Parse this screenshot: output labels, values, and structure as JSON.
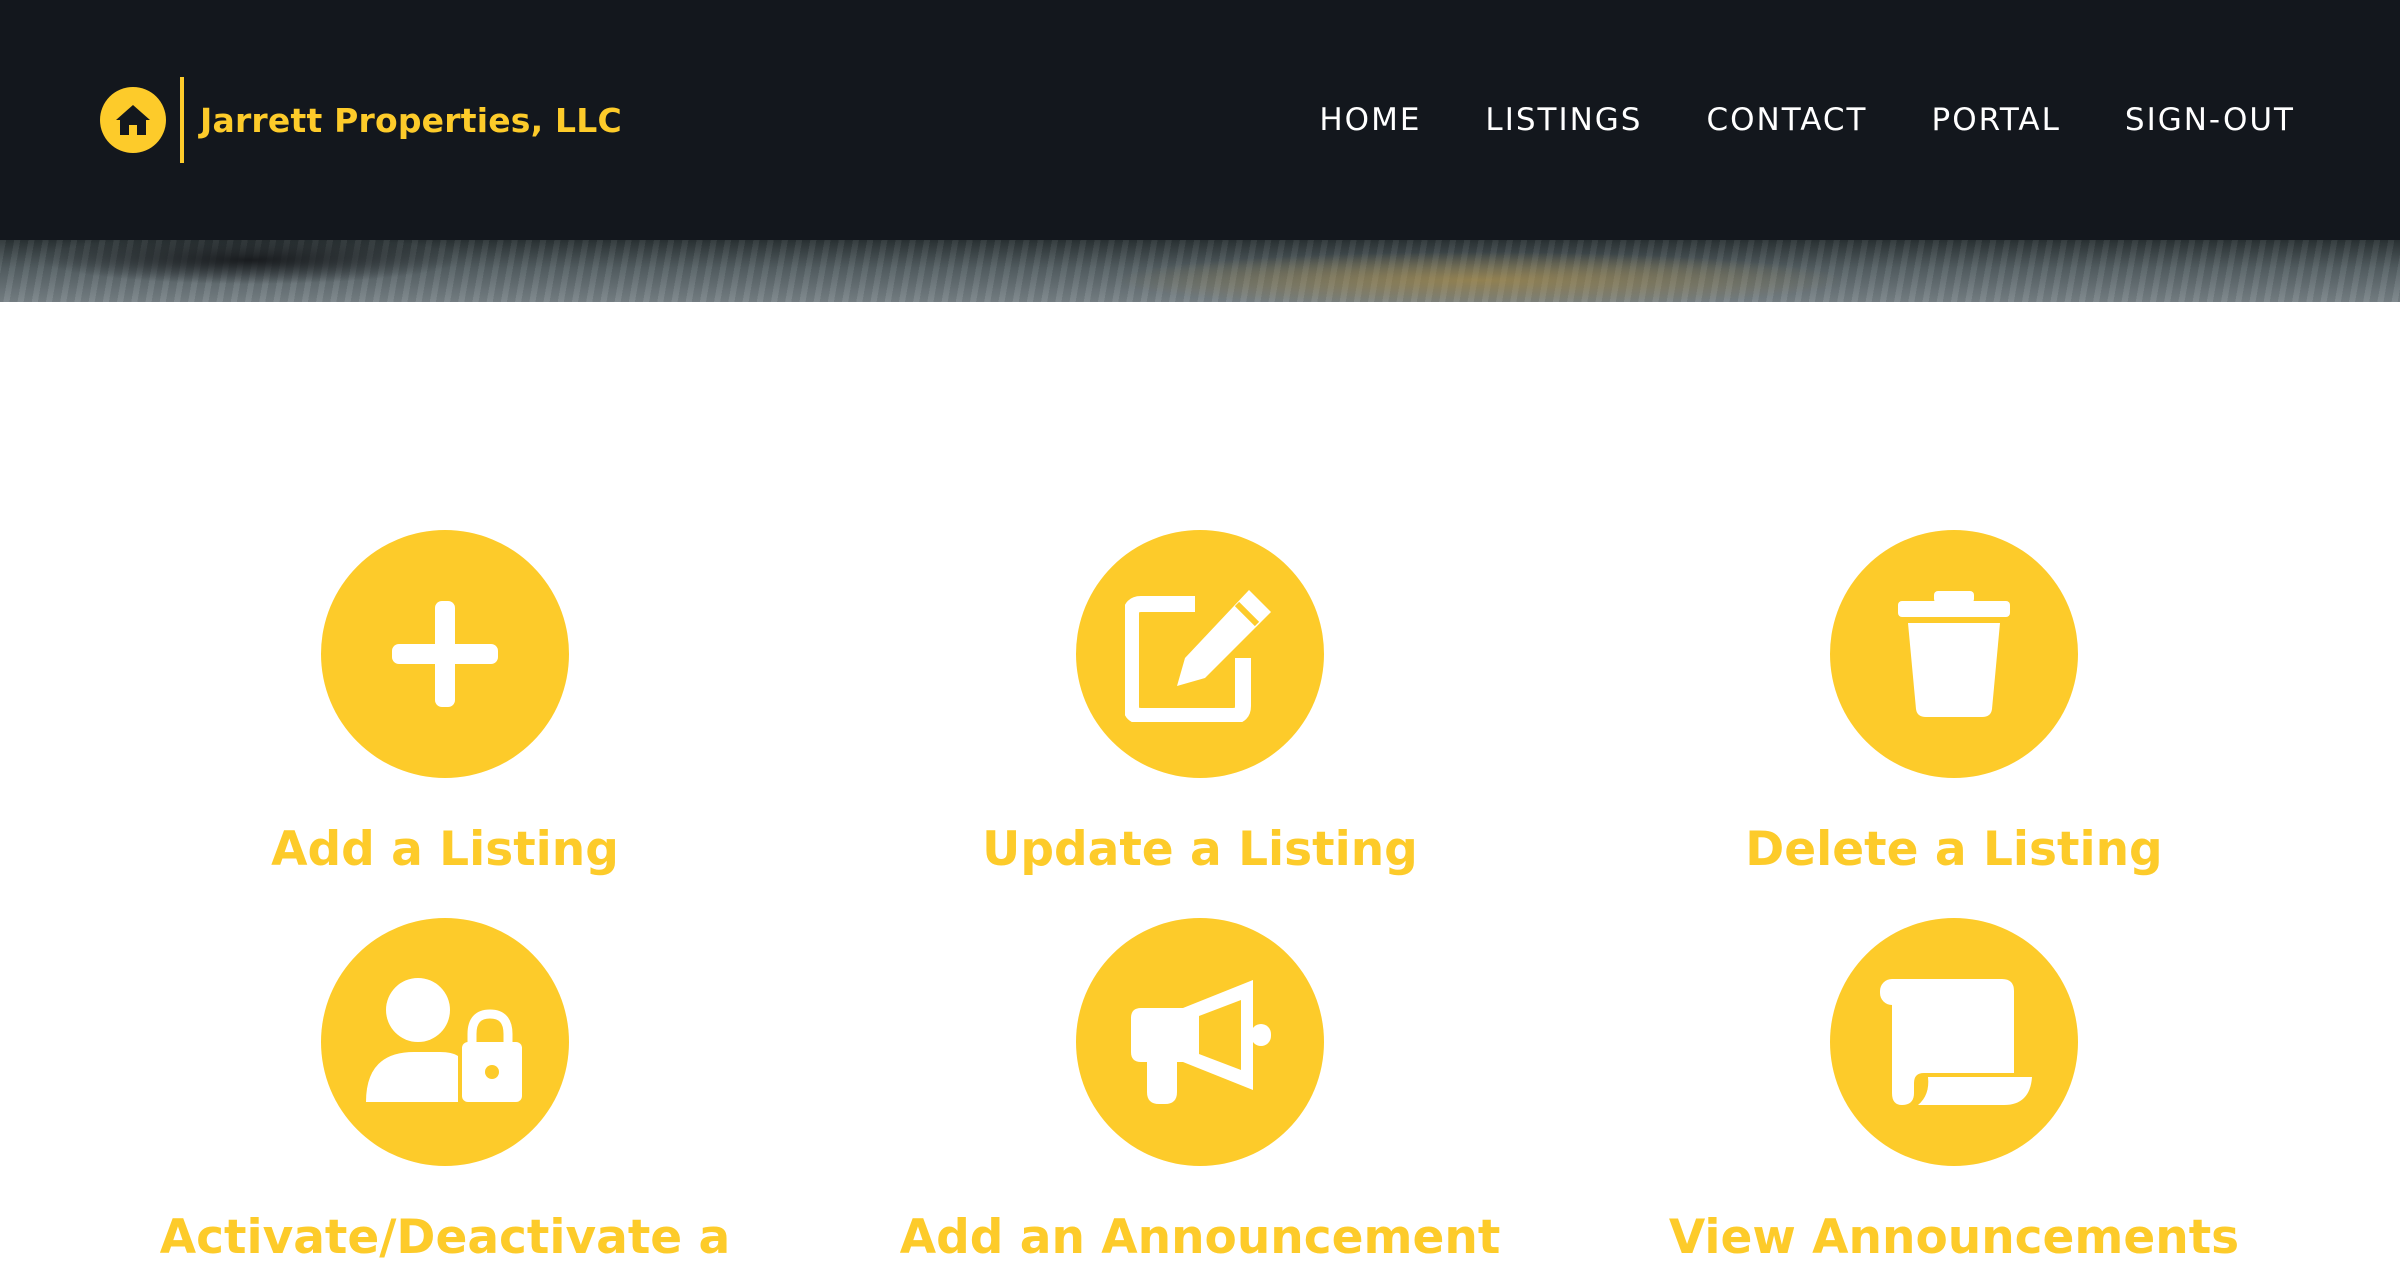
{
  "brand": {
    "name": "Jarrett Properties, LLC",
    "logo_icon": "home-icon",
    "color": "#fdcb2a"
  },
  "nav": {
    "items": [
      {
        "label": "HOME"
      },
      {
        "label": "LISTINGS"
      },
      {
        "label": "CONTACT"
      },
      {
        "label": "PORTAL"
      },
      {
        "label": "SIGN-OUT"
      }
    ],
    "background": "#13171d"
  },
  "actions": [
    {
      "label": "Add a Listing",
      "icon": "plus-icon"
    },
    {
      "label": "Update a Listing",
      "icon": "edit-icon"
    },
    {
      "label": "Delete a Listing",
      "icon": "trash-icon"
    },
    {
      "label": "Activate/Deactivate a",
      "icon": "user-lock-icon"
    },
    {
      "label": "Add an Announcement",
      "icon": "megaphone-icon"
    },
    {
      "label": "View Announcements",
      "icon": "scroll-icon"
    }
  ],
  "accent_color": "#fdcb2a"
}
